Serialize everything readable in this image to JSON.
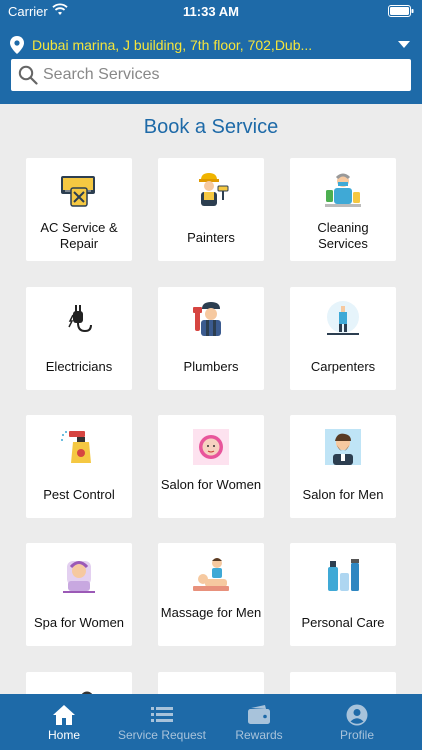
{
  "status_bar": {
    "carrier": "Carrier",
    "time": "11:33 AM"
  },
  "location": {
    "address": "Dubai marina, J building, 7th floor, 702,Dub..."
  },
  "search": {
    "placeholder": "Search Services"
  },
  "section": {
    "title": "Book a Service"
  },
  "services": [
    {
      "label": "AC Service & Repair",
      "icon": "ac-icon"
    },
    {
      "label": "Painters",
      "icon": "painter-icon"
    },
    {
      "label": "Cleaning Services",
      "icon": "cleaning-icon"
    },
    {
      "label": "Electricians",
      "icon": "plug-icon"
    },
    {
      "label": "Plumbers",
      "icon": "plumber-icon"
    },
    {
      "label": "Carpenters",
      "icon": "carpenter-icon"
    },
    {
      "label": "Pest Control",
      "icon": "spray-icon"
    },
    {
      "label": "Salon for Women",
      "icon": "salon-women-icon"
    },
    {
      "label": "Salon for Men",
      "icon": "salon-men-icon"
    },
    {
      "label": "Spa for Women",
      "icon": "spa-icon"
    },
    {
      "label": "Massage for Men",
      "icon": "massage-icon"
    },
    {
      "label": "Personal Care",
      "icon": "personal-care-icon"
    },
    {
      "label": "",
      "icon": "tools-icon"
    },
    {
      "label": "",
      "icon": "worker-icon"
    },
    {
      "label": "",
      "icon": "clipboard-icon"
    }
  ],
  "tabs": [
    {
      "label": "Home",
      "icon": "home-icon",
      "active": true
    },
    {
      "label": "Service Request",
      "icon": "list-icon",
      "active": false
    },
    {
      "label": "Rewards",
      "icon": "wallet-icon",
      "active": false
    },
    {
      "label": "Profile",
      "icon": "profile-icon",
      "active": false
    }
  ],
  "colors": {
    "primary": "#1e6aa8",
    "address": "#f5e53b",
    "background": "#ececec"
  }
}
